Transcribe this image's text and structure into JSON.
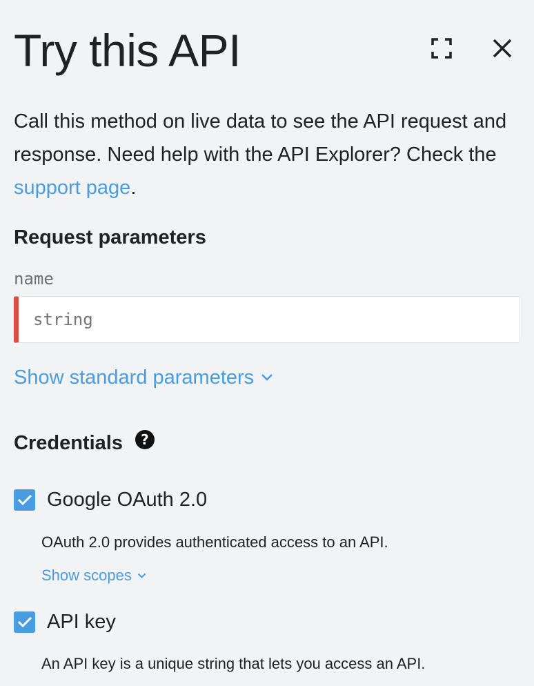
{
  "header": {
    "title": "Try this API",
    "fullscreen_icon": "fullscreen-icon",
    "close_icon": "close-icon"
  },
  "description": {
    "text_before_link": "Call this method on live data to see the API request and response. Need help with the API Explorer? Check the ",
    "link_text": "support page",
    "text_after_link": "."
  },
  "request_parameters": {
    "title": "Request parameters",
    "params": [
      {
        "label": "name",
        "placeholder": "string",
        "value": "",
        "required": true
      }
    ],
    "show_standard_label": "Show standard parameters"
  },
  "credentials": {
    "title": "Credentials",
    "help_icon": "help-icon",
    "items": [
      {
        "label": "Google OAuth 2.0",
        "checked": true,
        "description": "OAuth 2.0 provides authenticated access to an API.",
        "show_scopes_label": "Show scopes"
      },
      {
        "label": "API key",
        "checked": true,
        "description": "An API key is a unique string that lets you access an API."
      }
    ]
  },
  "colors": {
    "background": "#f1f3f4",
    "link": "#4a9ce0",
    "required_marker": "#d9503f",
    "checkbox": "#4a9ce0"
  }
}
